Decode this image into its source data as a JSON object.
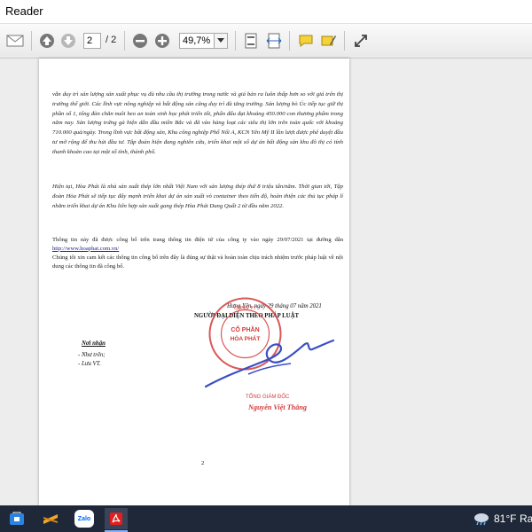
{
  "window": {
    "title": "Reader"
  },
  "toolbar": {
    "page_current": "2",
    "page_total": "/ 2",
    "zoom": "49,7%",
    "icons": [
      "mail-icon",
      "page-up-icon",
      "page-down-icon",
      "zoom-out-icon",
      "zoom-in-icon",
      "fit-page-icon",
      "fit-width-icon",
      "comment-icon",
      "highlight-icon",
      "fullscreen-icon"
    ]
  },
  "document": {
    "para1": "vẫn duy trì sản lượng sản xuất phục vụ đủ nhu cầu thị trường trong nước và giá bán ra luôn thấp hơn so với giá trên thị trường thế giới. Các lĩnh vực nông nghiệp và bất động sản cũng duy trì đà tăng trưởng. Sản lượng bò Úc tiếp tục giữ thị phần số 1, tổng đàn chăn nuôi heo an toàn sinh học phát triển tốt, phấn đấu đạt khoảng 450.000 con thương phẩm trong năm nay. Sản lượng trứng gà hiện dẫn đầu miền Bắc và đã vào hàng loạt các siêu thị lớn trên toàn quốc với khoảng 710.000 quả/ngày. Trong lĩnh vực bất động sản, Khu công nghiệp Phố Nối A, KCN Yên Mỹ II lần lượt được phê duyệt đầu tư mở rộng để thu hút đầu tư. Tập đoàn hiện đang nghiên cứu, triển khai một số dự án bất động sản khu đô thị có tính thanh khoản cao tại một số tỉnh, thành phố.",
    "para2": "Hiện tại, Hòa Phát là nhà sản xuất thép lớn nhất Việt Nam với sản lượng thép thứ 8 triệu tấn/năm. Thời gian tới, Tập đoàn Hòa Phát sẽ tiếp tục đẩy mạnh triển khai dự án sản xuất vỏ container theo tiến độ, hoàn thiện các thủ tục pháp lí nhằm triển khai dự án Khu liên hợp sản xuất gang thép Hòa Phát Dung Quất 2 từ đầu năm 2022.",
    "para3_prefix": "Thông tin này đã được công bố trên trang thông tin điện tử của công ty vào ngày 29/07/2021 tại đường dẫn ",
    "para3_link": "http://www.hoaphat.com.vn/",
    "para4": "Chúng tôi xin cam kết các thông tin công bố trên đây là đúng sự thật và hoàn toàn chịu trách nhiệm trước pháp luật về nội dung các thông tin đã công bố.",
    "sign_place": "Hưng Yên, ngày 29 tháng 07 năm 2021",
    "sign_title": "NGƯỜI ĐẠI DIỆN THEO PHÁP LUẬT",
    "recipients_title": "Nơi nhận",
    "recipient1": "-   Như trên;",
    "recipient2": "-   Lưu VT.",
    "stamp_text": "CÔNG TY CỔ PHẦN TẬP ĐOÀN HÒA PHÁT",
    "signer_role": "TỔNG GIÁM ĐỐC",
    "signer_name": "Nguyễn Việt Thắng",
    "page_number": "2"
  },
  "taskbar": {
    "apps": [
      "store-icon",
      "sublime-icon",
      "zalo-icon",
      "pdf-reader-icon"
    ],
    "zalo_label": "Zalo",
    "temperature": "81°F",
    "weather_text": "Rai"
  },
  "colors": {
    "stamp_red": "#d23b3b",
    "signature_blue": "#3a4fc4",
    "taskbar_bg": "#1f2838"
  }
}
